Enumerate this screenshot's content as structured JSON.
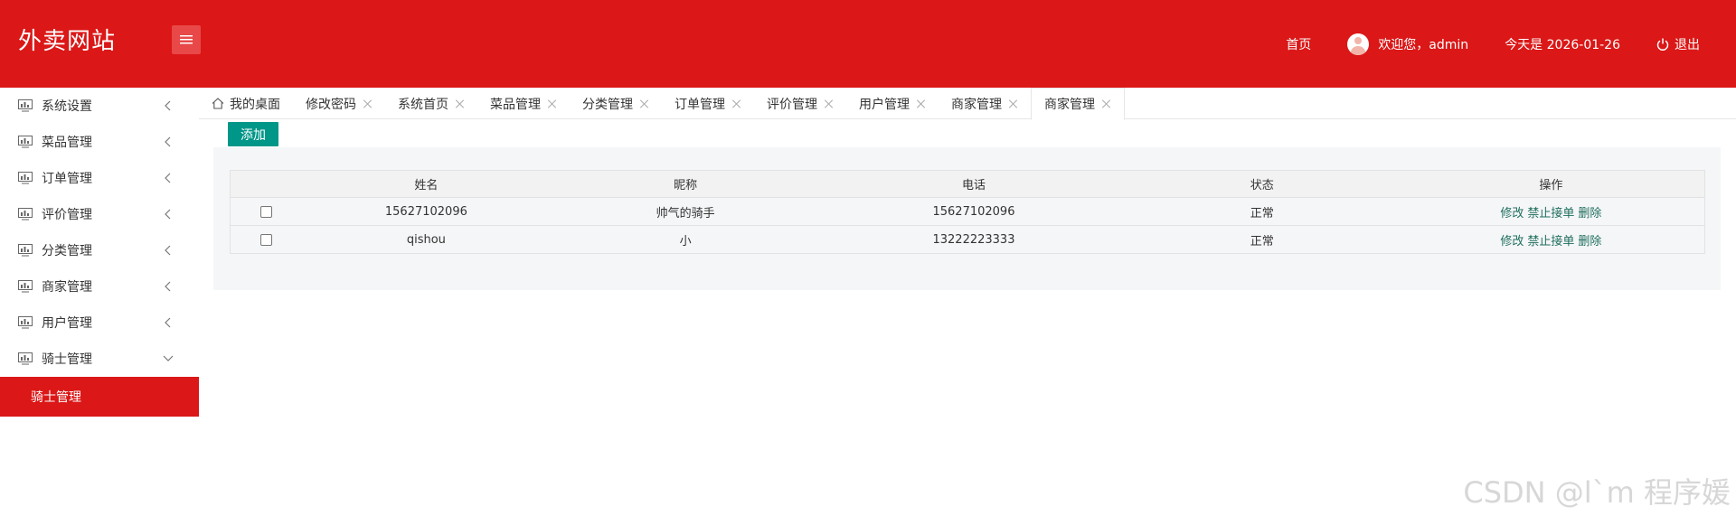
{
  "header": {
    "logo": "外卖网站",
    "home_link": "首页",
    "welcome": "欢迎您，admin",
    "date": "今天是 2026-01-26",
    "logout": "退出"
  },
  "sidebar": {
    "items": [
      {
        "label": "系统设置",
        "icon": "monitor-icon",
        "expanded": false
      },
      {
        "label": "菜品管理",
        "icon": "monitor-icon",
        "expanded": false
      },
      {
        "label": "订单管理",
        "icon": "monitor-icon",
        "expanded": false
      },
      {
        "label": "评价管理",
        "icon": "monitor-icon",
        "expanded": false
      },
      {
        "label": "分类管理",
        "icon": "monitor-icon",
        "expanded": false
      },
      {
        "label": "商家管理",
        "icon": "monitor-icon",
        "expanded": false
      },
      {
        "label": "用户管理",
        "icon": "monitor-icon",
        "expanded": false
      },
      {
        "label": "骑士管理",
        "icon": "monitor-icon",
        "expanded": true
      }
    ],
    "active_sub": "骑士管理"
  },
  "tabs": [
    {
      "label": "我的桌面",
      "closable": false
    },
    {
      "label": "修改密码",
      "closable": true
    },
    {
      "label": "系统首页",
      "closable": true
    },
    {
      "label": "菜品管理",
      "closable": true
    },
    {
      "label": "分类管理",
      "closable": true
    },
    {
      "label": "订单管理",
      "closable": true
    },
    {
      "label": "评价管理",
      "closable": true
    },
    {
      "label": "用户管理",
      "closable": true
    },
    {
      "label": "商家管理",
      "closable": true
    },
    {
      "label": "商家管理",
      "closable": true,
      "active": true
    }
  ],
  "toolbar": {
    "add_label": "添加"
  },
  "table": {
    "columns": [
      "",
      "姓名",
      "昵称",
      "电话",
      "状态",
      "操作"
    ],
    "rows": [
      {
        "name": "15627102096",
        "nickname": "帅气的骑手",
        "phone": "15627102096",
        "status": "正常"
      },
      {
        "name": "qishou",
        "nickname": "小",
        "phone": "13222223333",
        "status": "正常"
      }
    ],
    "actions": {
      "edit": "修改",
      "ban": "禁止接单",
      "delete": "删除"
    }
  },
  "watermark": "CSDN @l`m 程序媛",
  "colors": {
    "header": "#db1717",
    "add_button": "#009688",
    "active_sub": "#db1717"
  }
}
